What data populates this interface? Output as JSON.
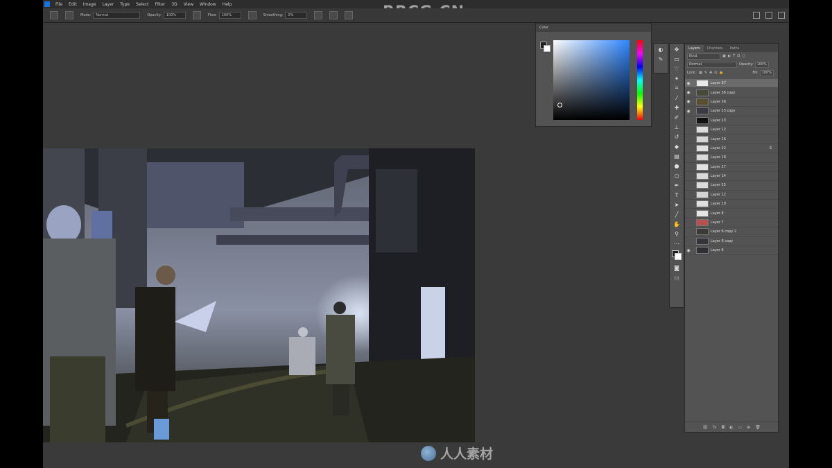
{
  "menubar": {
    "items": [
      "File",
      "Edit",
      "Image",
      "Layer",
      "Type",
      "Select",
      "Filter",
      "3D",
      "View",
      "Window",
      "Help"
    ]
  },
  "watermarks": {
    "top": "RRCG.CN",
    "bottom": "人人素材"
  },
  "options_bar": {
    "mode_label": "Mode:",
    "mode_value": "Normal",
    "opacity_label": "Opacity:",
    "opacity_value": "100%",
    "flow_label": "Flow:",
    "flow_value": "100%",
    "smoothing_label": "Smoothing:",
    "smoothing_value": "0%"
  },
  "color_panel": {
    "title": "Color",
    "foreground": "#1e1e1e",
    "background": "#ffffff",
    "hue_color": "#2f86ff"
  },
  "layers_panel": {
    "tabs": [
      "Layers",
      "Channels",
      "Paths"
    ],
    "filter_label": "Kind",
    "blend_mode": "Normal",
    "opacity_label": "Opacity:",
    "opacity_value": "100%",
    "lock_label": "Lock:",
    "fill_label": "Fill:",
    "fill_value": "100%",
    "layers": [
      {
        "name": "Layer 37",
        "visible": true,
        "selected": true,
        "thumb": "#e8e8e8"
      },
      {
        "name": "Layer 36 copy",
        "visible": true,
        "selected": false,
        "thumb": "#4a4a3a"
      },
      {
        "name": "Layer 36",
        "visible": true,
        "selected": false,
        "thumb": "#5a5030"
      },
      {
        "name": "Layer 23 copy",
        "visible": true,
        "selected": false,
        "thumb": "#3b3a44"
      },
      {
        "name": "Layer 23",
        "visible": false,
        "selected": false,
        "thumb": "#111111"
      },
      {
        "name": "Layer 12",
        "visible": false,
        "selected": false,
        "thumb": "#dddddd"
      },
      {
        "name": "Layer 16",
        "visible": false,
        "selected": false,
        "thumb": "#d6d6d6"
      },
      {
        "name": "Layer 22",
        "visible": false,
        "selected": false,
        "thumb": "#e0e0e0",
        "flag": "⇭"
      },
      {
        "name": "Layer 18",
        "visible": false,
        "selected": false,
        "thumb": "#dadada"
      },
      {
        "name": "Layer 17",
        "visible": false,
        "selected": false,
        "thumb": "#e2e2e2"
      },
      {
        "name": "Layer 14",
        "visible": false,
        "selected": false,
        "thumb": "#d8d8d8"
      },
      {
        "name": "Layer 25",
        "visible": false,
        "selected": false,
        "thumb": "#dcdcdc"
      },
      {
        "name": "Layer 12",
        "visible": false,
        "selected": false,
        "thumb": "#d4d4d4"
      },
      {
        "name": "Layer 10",
        "visible": false,
        "selected": false,
        "thumb": "#dedede"
      },
      {
        "name": "Layer 8",
        "visible": false,
        "selected": false,
        "thumb": "#e4e4e4"
      },
      {
        "name": "Layer 7",
        "visible": false,
        "selected": false,
        "thumb": "#b85050"
      },
      {
        "name": "Layer 6 copy 2",
        "visible": false,
        "selected": false,
        "thumb": "#3a3a36"
      },
      {
        "name": "Layer 6 copy",
        "visible": false,
        "selected": false,
        "thumb": "#34343a"
      },
      {
        "name": "Layer 6",
        "visible": true,
        "selected": false,
        "thumb": "#303034"
      }
    ]
  },
  "tools": [
    "move-tool",
    "marquee-tool",
    "lasso-tool",
    "quick-select-tool",
    "crop-tool",
    "eyedropper-tool",
    "healing-tool",
    "brush-tool",
    "stamp-tool",
    "history-brush-tool",
    "eraser-tool",
    "gradient-tool",
    "blur-tool",
    "dodge-tool",
    "pen-tool",
    "type-tool",
    "path-select-tool",
    "line-tool",
    "hand-tool",
    "zoom-tool"
  ]
}
